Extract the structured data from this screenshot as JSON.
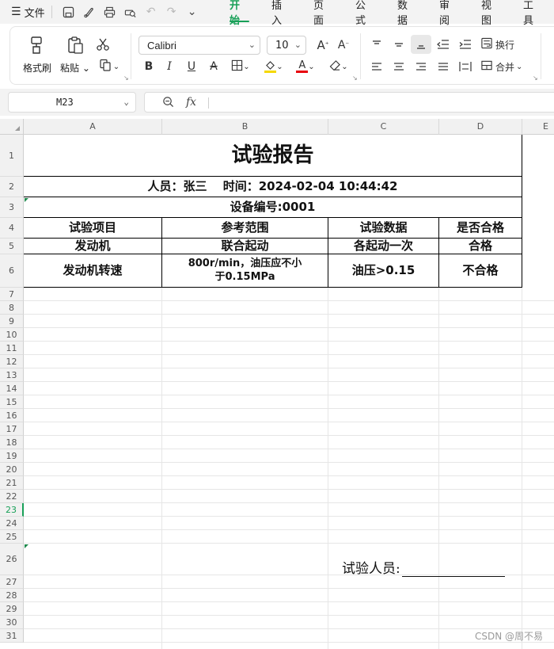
{
  "menubar": {
    "file_label": "文件",
    "tabs": [
      {
        "label": "开始",
        "active": true
      },
      {
        "label": "插入"
      },
      {
        "label": "页面"
      },
      {
        "label": "公式"
      },
      {
        "label": "数据"
      },
      {
        "label": "审阅"
      },
      {
        "label": "视图"
      },
      {
        "label": "工具"
      }
    ],
    "quick_access_icons": [
      "save-icon",
      "format-brush-icon",
      "print-icon",
      "print-preview-icon",
      "undo-icon",
      "redo-icon",
      "more-icon"
    ]
  },
  "ribbon": {
    "format_painter_label": "格式刷",
    "paste_label": "粘贴",
    "font_name": "Calibri",
    "font_size": "10",
    "wrap_label": "换行",
    "merge_label": "合并",
    "accent_color": "#18a058",
    "fill_color": "#f5d800",
    "font_color": "#e8000b"
  },
  "formula_bar": {
    "cell_ref": "M23",
    "fx_label": "fx",
    "content": ""
  },
  "columns": [
    "A",
    "B",
    "C",
    "D",
    "E"
  ],
  "rows": [
    "1",
    "2",
    "3",
    "4",
    "5",
    "6",
    "7",
    "8",
    "9",
    "10",
    "11",
    "12",
    "13",
    "14",
    "15",
    "16",
    "17",
    "18",
    "19",
    "20",
    "21",
    "22",
    "23",
    "24",
    "25",
    "26",
    "27",
    "28",
    "29",
    "30",
    "31"
  ],
  "selected_row": "23",
  "report": {
    "title": "试验报告",
    "person_time": "人员：张三　 时间：2024-02-04 10:44:42",
    "device_no": "设备编号:0001",
    "headers": [
      "试验项目",
      "参考范围",
      "试验数据",
      "是否合格"
    ],
    "rows": [
      [
        "发动机",
        "联合起动",
        "各起动一次",
        "合格"
      ],
      [
        "发动机转速",
        "800r/min，油压应不小于0.15MPa",
        "油压>0.15",
        "不合格"
      ]
    ],
    "signer_label": "试验人员:"
  },
  "watermark": "CSDN @周不易"
}
